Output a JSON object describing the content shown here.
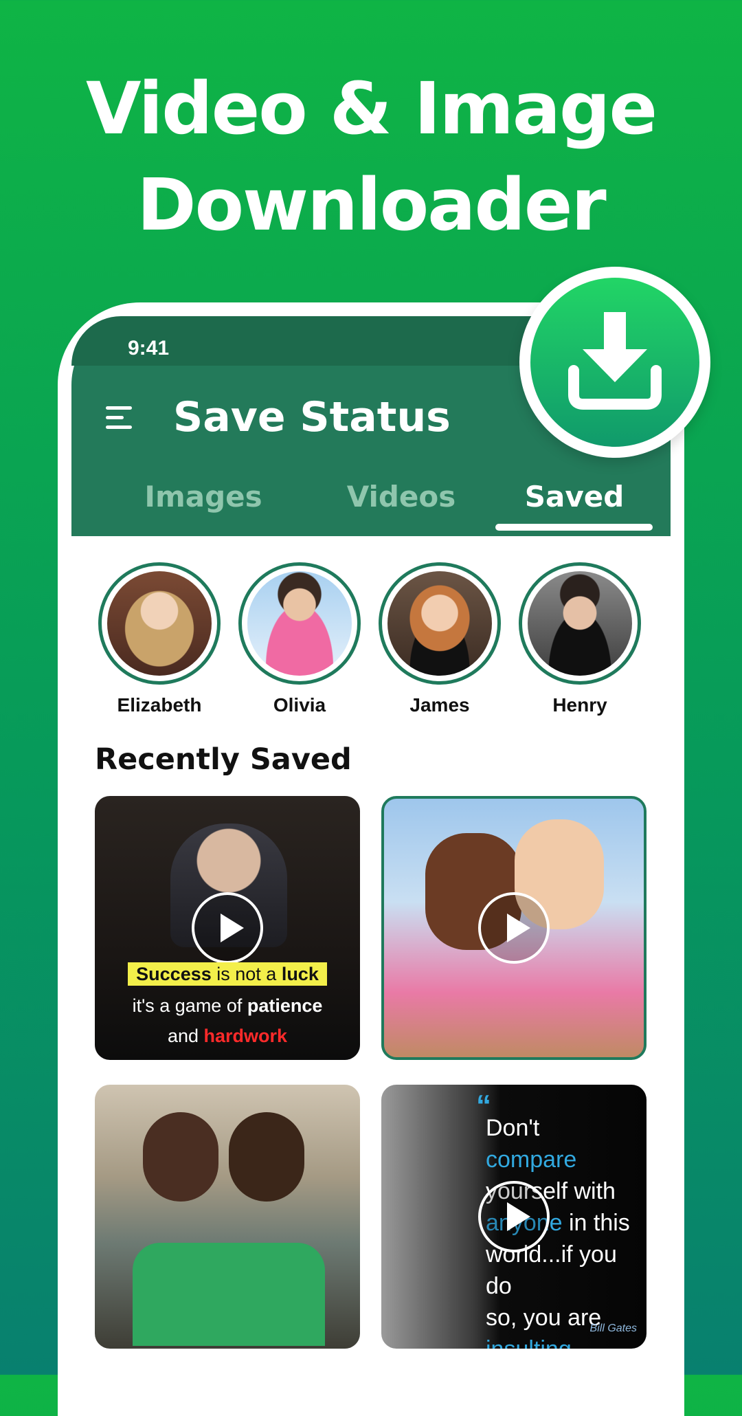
{
  "promo": {
    "headline_line1": "Video & Image",
    "headline_line2": "Downloader"
  },
  "status_bar": {
    "time": "9:41"
  },
  "app_bar": {
    "title": "Save Status"
  },
  "tabs": [
    {
      "label": "Images",
      "active": false
    },
    {
      "label": "Videos",
      "active": false
    },
    {
      "label": "Saved",
      "active": true
    }
  ],
  "stories": [
    {
      "name": "Elizabeth"
    },
    {
      "name": "Olivia"
    },
    {
      "name": "James"
    },
    {
      "name": "Henry"
    }
  ],
  "recent": {
    "title": "Recently Saved",
    "items": [
      {
        "type": "video",
        "caption_l1a": "Success",
        "caption_l1b": " is not a ",
        "caption_l1c": "luck",
        "caption_l2a": "it's a game of ",
        "caption_l2b": "patience",
        "caption_l3a": "and ",
        "caption_l3b": "hardwork"
      },
      {
        "type": "video",
        "selected": true
      },
      {
        "type": "image"
      },
      {
        "type": "video",
        "quote_mark": "“",
        "q1": "Don't ",
        "q1b": "compare",
        "q2": "yourself with",
        "q3": "anyone",
        "q3b": " in this",
        "q4": "world...if you do",
        "q5": "so, you are",
        "q6": "insulting yourself.",
        "author": "Bill Gates"
      }
    ]
  },
  "colors": {
    "brand": "#0fb445",
    "app_bar": "#237a5a",
    "accent_ring": "#1f7a5c"
  }
}
